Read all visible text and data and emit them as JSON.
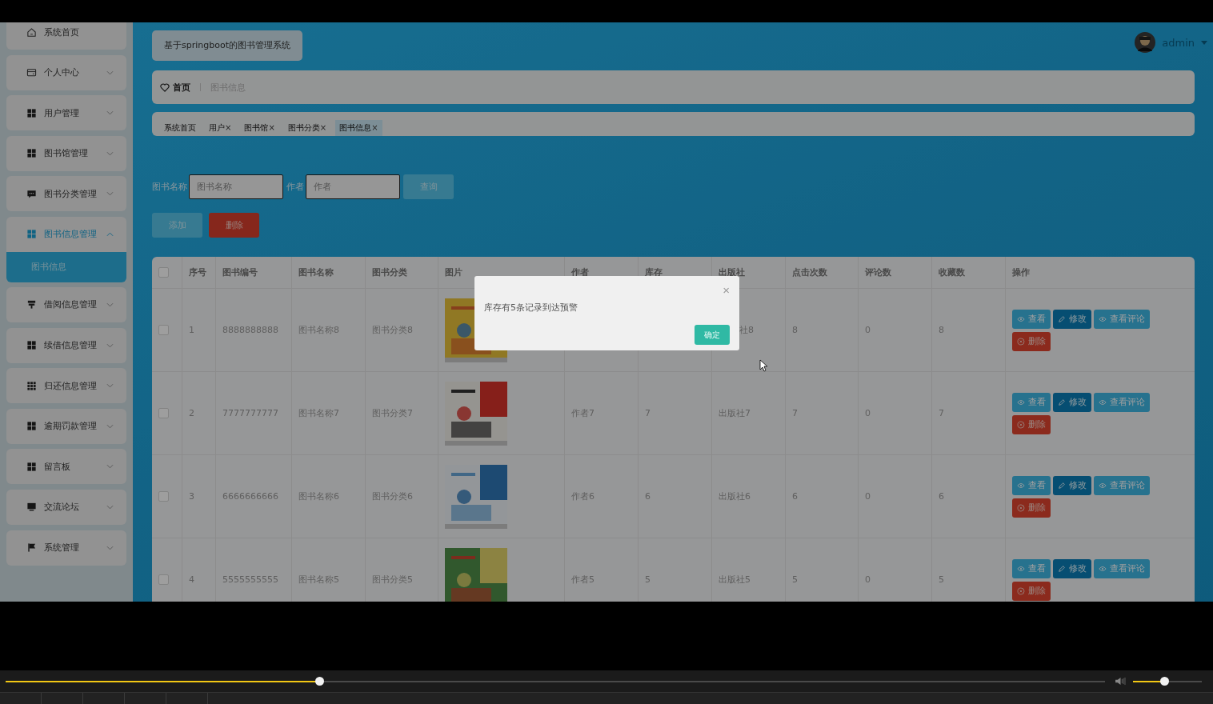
{
  "sidebar": {
    "items": [
      {
        "label": "系统首页"
      },
      {
        "label": "个人中心",
        "expanded": false
      },
      {
        "label": "用户管理",
        "expanded": false
      },
      {
        "label": "图书馆管理",
        "expanded": false
      },
      {
        "label": "图书分类管理",
        "expanded": false
      },
      {
        "label": "图书信息管理",
        "expanded": true,
        "children": [
          {
            "label": "图书信息",
            "selected": true
          }
        ]
      },
      {
        "label": "借阅信息管理",
        "expanded": false
      },
      {
        "label": "续借信息管理",
        "expanded": false
      },
      {
        "label": "归还信息管理",
        "expanded": false
      },
      {
        "label": "逾期罚款管理",
        "expanded": false
      },
      {
        "label": "留言板",
        "expanded": false
      },
      {
        "label": "交流论坛",
        "expanded": false
      },
      {
        "label": "系统管理",
        "expanded": false
      }
    ]
  },
  "header": {
    "title": "基于springboot的图书管理系统",
    "user": "admin"
  },
  "breadcrumb": {
    "home": "首页",
    "current": "图书信息"
  },
  "tags": [
    {
      "label": "系统首页",
      "selected": false
    },
    {
      "label": "用户",
      "close": "×",
      "selected": false
    },
    {
      "label": "图书馆",
      "close": "×",
      "selected": false
    },
    {
      "label": "图书分类",
      "close": "×",
      "selected": false
    },
    {
      "label": "图书信息",
      "close": "×",
      "selected": true
    }
  ],
  "search": {
    "name_label": "图书名称",
    "name_placeholder": "图书名称",
    "author_label": "作者",
    "author_placeholder": "作者",
    "button": "查询"
  },
  "toolbar": {
    "add": "添加",
    "delete": "删除"
  },
  "table": {
    "all_checked": false,
    "columns": [
      "序号",
      "图书编号",
      "图书名称",
      "图书分类",
      "图片",
      "作者",
      "库存",
      "出版社",
      "点击次数",
      "评论数",
      "收藏数",
      "操作"
    ],
    "rows": [
      {
        "checked": false,
        "cells": [
          "1",
          "8888888888",
          "图书名称8",
          "图书分类8",
          null,
          null,
          null,
          "社8",
          "8",
          "0",
          "8"
        ],
        "actions": [
          {
            "kind": "view",
            "label": "查看"
          },
          {
            "kind": "edit",
            "label": "修改"
          },
          {
            "kind": "comments",
            "label": "查看评论"
          },
          {
            "kind": "delete",
            "label": "删除"
          }
        ]
      },
      {
        "checked": false,
        "cells": [
          "2",
          "7777777777",
          "图书名称7",
          "图书分类7",
          null,
          "作者7",
          "7",
          "出版社7",
          "7",
          "0",
          "7"
        ],
        "actions": [
          {
            "kind": "view",
            "label": "查看"
          },
          {
            "kind": "edit",
            "label": "修改"
          },
          {
            "kind": "comments",
            "label": "查看评论"
          },
          {
            "kind": "delete",
            "label": "删除"
          }
        ]
      },
      {
        "checked": false,
        "cells": [
          "3",
          "6666666666",
          "图书名称6",
          "图书分类6",
          null,
          "作者6",
          "6",
          "出版社6",
          "6",
          "0",
          "6"
        ],
        "actions": [
          {
            "kind": "view",
            "label": "查看"
          },
          {
            "kind": "edit",
            "label": "修改"
          },
          {
            "kind": "comments",
            "label": "查看评论"
          },
          {
            "kind": "delete",
            "label": "删除"
          }
        ]
      },
      {
        "checked": false,
        "cells": [
          "4",
          "5555555555",
          "图书名称5",
          "图书分类5",
          null,
          "作者5",
          "5",
          "出版社5",
          "5",
          "0",
          "5"
        ],
        "actions": [
          {
            "kind": "view",
            "label": "查看"
          },
          {
            "kind": "edit",
            "label": "修改"
          },
          {
            "kind": "comments",
            "label": "查看评论"
          },
          {
            "kind": "delete",
            "label": "删除"
          }
        ]
      }
    ]
  },
  "dialog": {
    "message": "库存有5条记录到达预警",
    "close": "×",
    "confirm": "确定"
  },
  "player": {
    "progress": {
      "level": 0.285
    },
    "volume": {
      "level": 0.45
    }
  }
}
